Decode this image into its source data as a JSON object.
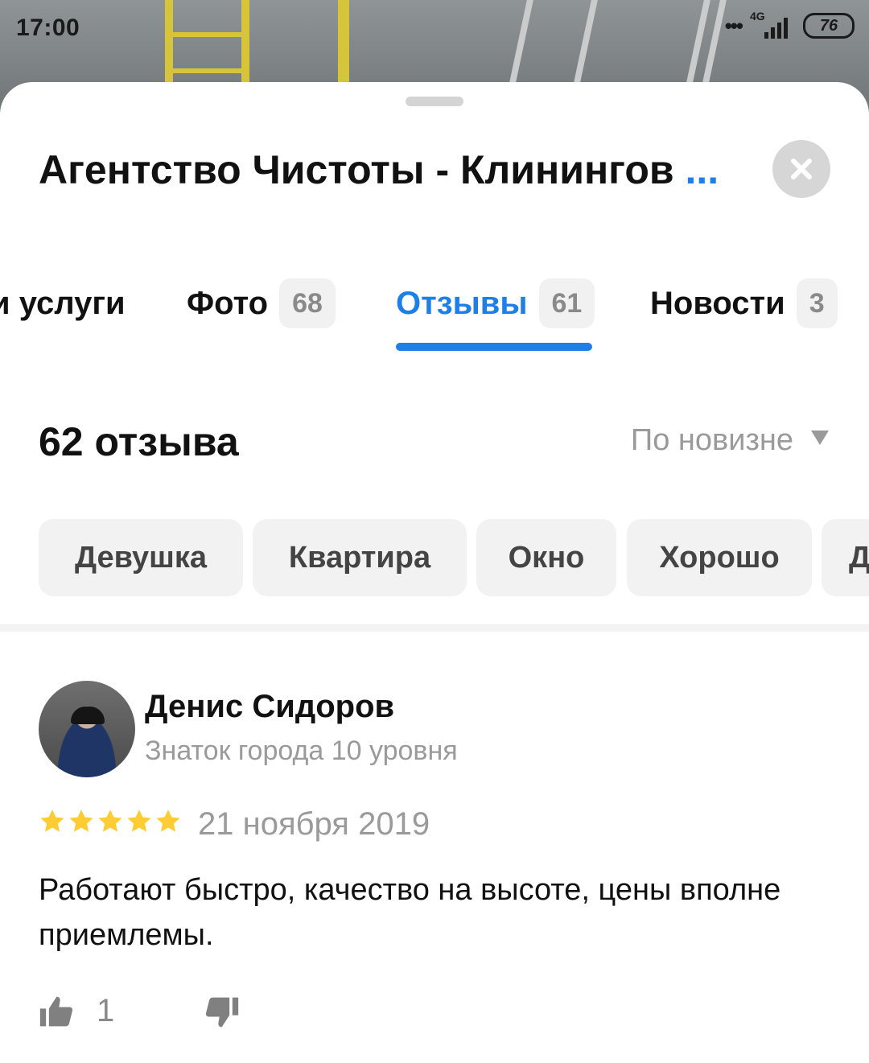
{
  "status_bar": {
    "time": "17:00",
    "dots": "•••",
    "network": "4G",
    "battery": "76"
  },
  "header": {
    "title": "Агентство Чистоты - Клинингов",
    "title_more": "..."
  },
  "tabs": [
    {
      "label": "и услуги",
      "count": ""
    },
    {
      "label": "Фото",
      "count": "68"
    },
    {
      "label": "Отзывы",
      "count": "61",
      "active": true
    },
    {
      "label": "Новости",
      "count": "3"
    }
  ],
  "reviews_header": {
    "count_title": "62 отзыва",
    "sort_label": "По новизне"
  },
  "chips": [
    "Девушка",
    "Квартира",
    "Окно",
    "Хорошо",
    "Д"
  ],
  "review": {
    "author": "Денис Сидоров",
    "level": "Знаток города 10 уровня",
    "rating": 5,
    "date": "21 ноября 2019",
    "text": "Работают быстро, качество на высоте, цены вполне приемлемы.",
    "likes": "1"
  },
  "colors": {
    "accent": "#1e7fe6",
    "star": "#ffcc33",
    "muted": "#9a9a9a",
    "chip_bg": "#f2f2f2"
  }
}
